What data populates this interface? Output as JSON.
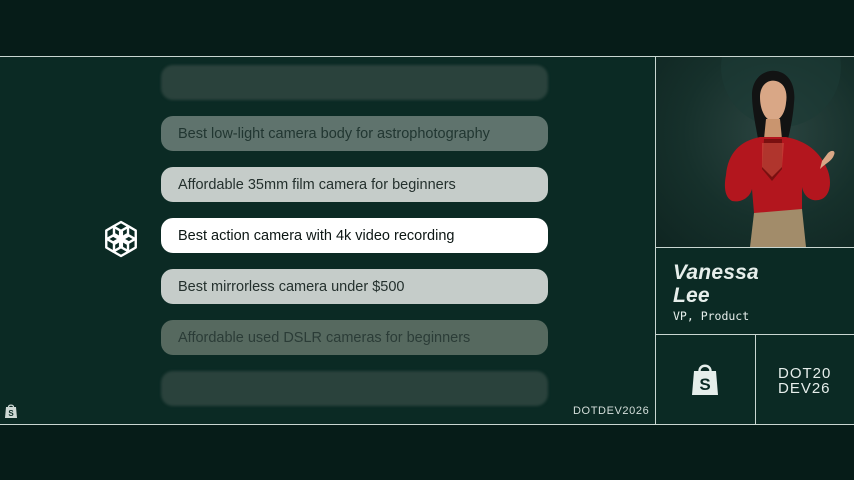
{
  "suggestions": [
    {
      "label": "",
      "state": "faint"
    },
    {
      "label": "Best low-light camera body for astrophotography",
      "state": "dim"
    },
    {
      "label": "Affordable 35mm film camera for beginners",
      "state": "near"
    },
    {
      "label": "Best action camera with 4k video recording",
      "state": "selected"
    },
    {
      "label": "Best mirrorless camera under $500",
      "state": "near"
    },
    {
      "label": "Affordable used DSLR cameras for beginners",
      "state": "dim"
    },
    {
      "label": "",
      "state": "faint"
    }
  ],
  "speaker": {
    "first_name": "Vanessa",
    "last_name": "Lee",
    "title": "VP, Product"
  },
  "footer": {
    "event_label": "DOTDEV2026"
  },
  "logo": {
    "line1": "DOT20",
    "line2": "DEV26"
  },
  "icons": {
    "assistant": "openai-logo-icon",
    "brand": "shopify-bag-icon"
  },
  "colors": {
    "background": "#0b2a24",
    "divider": "#c9d6d1",
    "selected": "#ffffff",
    "sweater": "#b3161e"
  }
}
